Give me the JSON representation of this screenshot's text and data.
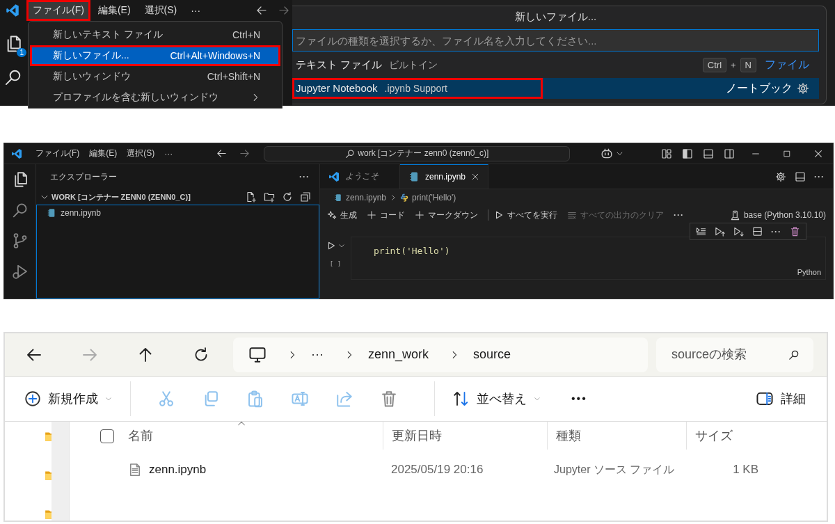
{
  "menu_snippet": {
    "menubar": [
      {
        "label": "ファイル(F)",
        "highlighted": true
      },
      {
        "label": "編集(E)",
        "highlighted": false
      },
      {
        "label": "選択(S)",
        "highlighted": false
      },
      {
        "label": "···",
        "highlighted": false
      }
    ],
    "badge": "1",
    "menu": [
      {
        "label": "新しいテキスト ファイル",
        "shortcut": "Ctrl+N",
        "selected": false,
        "highlighted": false,
        "submenu": false
      },
      {
        "label": "新しいファイル...",
        "shortcut": "Ctrl+Alt+Windows+N",
        "selected": true,
        "highlighted": true,
        "submenu": false
      },
      {
        "label": "新しいウィンドウ",
        "shortcut": "Ctrl+Shift+N",
        "selected": false,
        "highlighted": false,
        "submenu": false
      },
      {
        "label": "プロファイルを含む新しいウィンドウ",
        "selected": false,
        "highlighted": false,
        "submenu": true
      }
    ]
  },
  "quick_pick": {
    "title": "新しいファイル...",
    "placeholder": "ファイルの種類を選択するか、ファイル名を入力してください...",
    "items": [
      {
        "label": "テキスト ファイル",
        "detail": "ビルトイン",
        "keys": [
          "Ctrl",
          "N"
        ],
        "key_joiner": "+",
        "category": "ファイル",
        "selected": false,
        "highlighted": false,
        "settings": false
      },
      {
        "label": "Jupyter Notebook",
        "detail": ".ipynb Support",
        "category": "ノートブック",
        "selected": true,
        "highlighted": true,
        "settings": true
      }
    ]
  },
  "vscode": {
    "menubar": [
      "ファイル(F)",
      "編集(E)",
      "選択(S)",
      "···"
    ],
    "command_center": "work [コンテナー zenn0 (zenn0_c)]",
    "explorer": {
      "title": "エクスプローラー",
      "more": "···",
      "folder": "WORK [コンテナー ZENN0 (ZENN0_C)]",
      "expanded": true,
      "files": [
        {
          "name": "zenn.ipynb"
        }
      ]
    },
    "tabs": [
      {
        "label": "ようこそ",
        "selected": false,
        "preview": true,
        "kind": "welcome"
      },
      {
        "label": "zenn.ipynb",
        "selected": true,
        "preview": false,
        "kind": "notebook"
      }
    ],
    "tab_more": "···",
    "breadcrumb": [
      "zenn.ipynb",
      "print('Hello')"
    ],
    "toolbar": [
      {
        "label": "生成",
        "kind": "generate",
        "disabled": false
      },
      {
        "label": "コード",
        "kind": "add",
        "disabled": false
      },
      {
        "label": "マークダウン",
        "kind": "add",
        "disabled": false
      },
      {
        "label": "すべてを実行",
        "kind": "run",
        "disabled": false
      },
      {
        "label": "すべての出力のクリア",
        "kind": "clear",
        "disabled": true
      }
    ],
    "toolbar_more": "···",
    "kernel": "base (Python 3.10.10)",
    "cell": {
      "code": "print('Hello')",
      "execution": "[ ]",
      "language": "Python",
      "toolbar_more": "···"
    }
  },
  "file_explorer": {
    "breadcrumb": [
      "···",
      "zenn_work",
      "source"
    ],
    "search_placeholder": "sourceの検索",
    "new_label": "新規作成",
    "sort_label": "並べ替え",
    "more": "•••",
    "details_label": "詳細",
    "select_all_checked": false,
    "columns": [
      "名前",
      "更新日時",
      "種類",
      "サイズ"
    ],
    "rows": [
      {
        "name": "zenn.ipynb",
        "modified": "2025/05/19 20:16",
        "type": "Jupyter ソース ファイル",
        "size": "1 KB",
        "selected": false
      }
    ]
  }
}
